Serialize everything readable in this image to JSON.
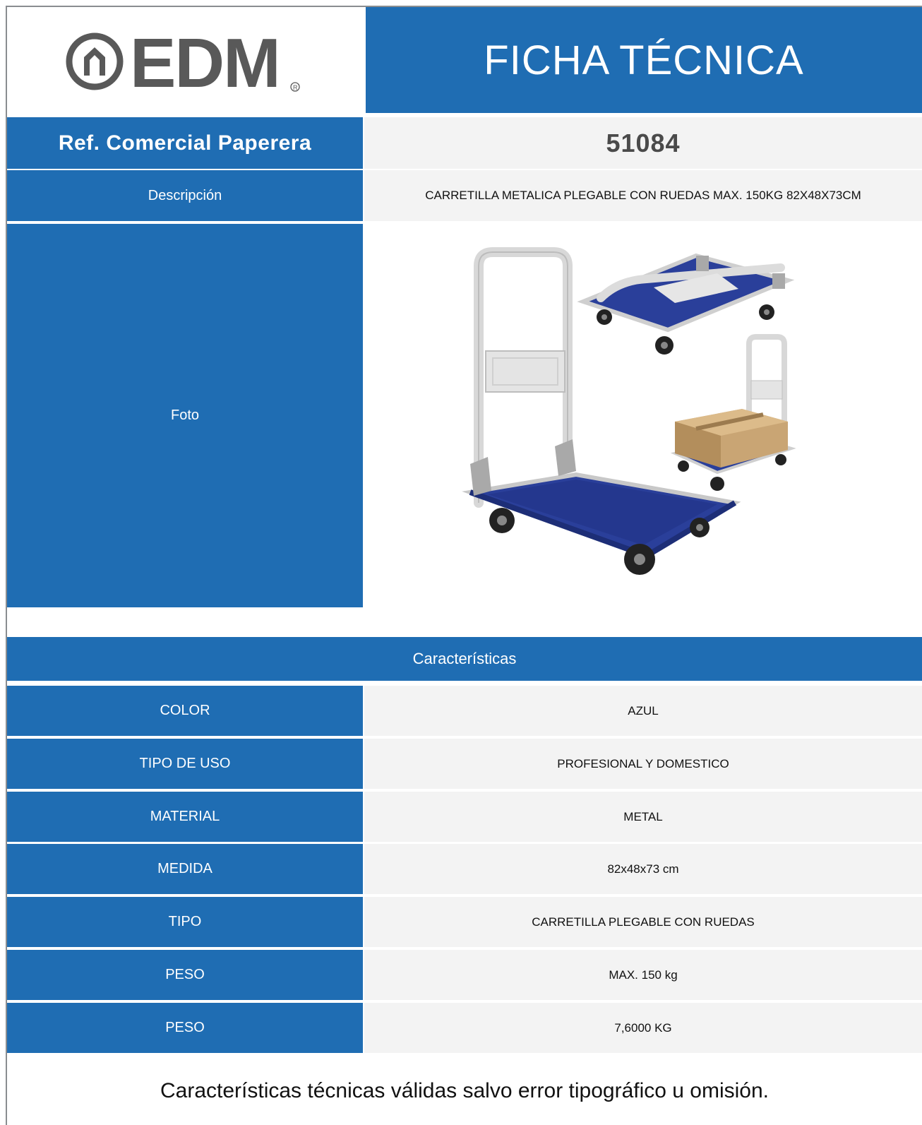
{
  "header": {
    "logo_text": "EDM",
    "title": "FICHA TÉCNICA"
  },
  "reference": {
    "label": "Ref. Comercial Paperera",
    "value": "51084"
  },
  "description": {
    "label": "Descripción",
    "value": "CARRETILLA METALICA PLEGABLE CON RUEDAS MAX. 150KG 82X48X73CM"
  },
  "photo": {
    "label": "Foto"
  },
  "features": {
    "header": "Características",
    "rows": [
      {
        "label": "COLOR",
        "value": "AZUL"
      },
      {
        "label": "TIPO DE USO",
        "value": "PROFESIONAL Y DOMESTICO"
      },
      {
        "label": "MATERIAL",
        "value": "METAL"
      },
      {
        "label": "MEDIDA",
        "value": "82x48x73 cm"
      },
      {
        "label": "TIPO",
        "value": "CARRETILLA PLEGABLE CON RUEDAS"
      },
      {
        "label": "PESO",
        "value": "MAX. 150 kg"
      },
      {
        "label": "PESO",
        "value": "7,6000 KG"
      }
    ]
  },
  "footer": {
    "note": "Características técnicas válidas salvo error tipográfico u omisión."
  },
  "colors": {
    "brand_blue": "#1f6db3",
    "cell_grey": "#f3f3f3",
    "logo_grey": "#595959"
  }
}
